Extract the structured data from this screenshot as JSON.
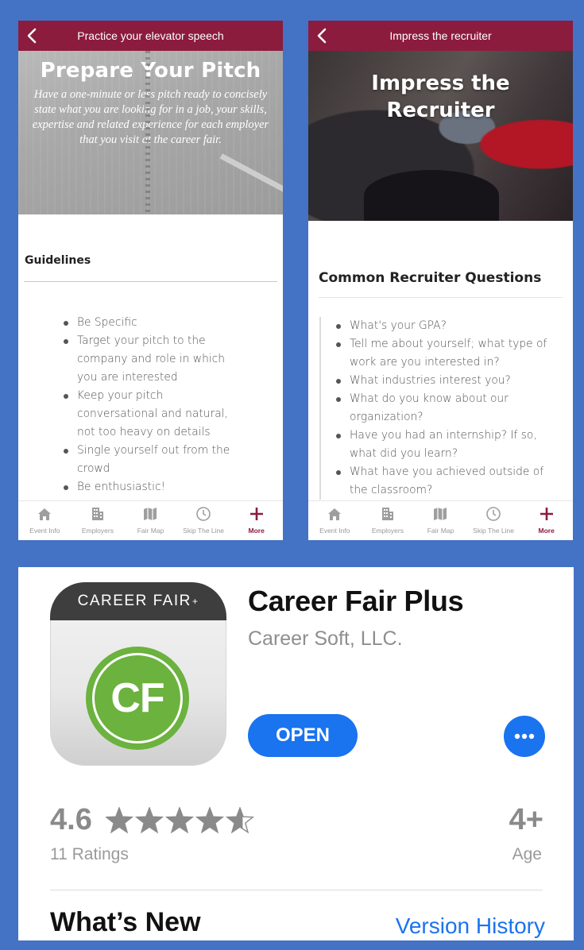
{
  "left_screen": {
    "title": "Practice your elevator speech",
    "hero_title": "Prepare Your Pitch",
    "hero_text": "Have a one-minute or less pitch ready to concisely state what you are looking for in a job, your skills, expertise and related experience for each employer that you visit at the career fair.",
    "section_heading": "Guidelines",
    "bullets": [
      "Be Specific",
      "Target your pitch to the company and role in which you are interested",
      "Keep your pitch conversational and natural, not too heavy on details",
      "Single yourself out from the crowd",
      "Be enthusiastic!"
    ]
  },
  "right_screen": {
    "title": "Impress the recruiter",
    "hero_title": "Impress the Recruiter",
    "section_heading": "Common Recruiter Questions",
    "bullets": [
      "What's your GPA?",
      "Tell me about yourself; what type of work are you interested in?",
      "What industries interest you?",
      "What do you know about our organization?",
      "Have you had an internship?  If so, what did you learn?",
      "What have you achieved outside of the classroom?"
    ]
  },
  "tabbar": {
    "tabs": [
      {
        "label": "Event Info",
        "icon": "home-icon"
      },
      {
        "label": "Employers",
        "icon": "building-icon"
      },
      {
        "label": "Fair Map",
        "icon": "map-icon"
      },
      {
        "label": "Skip The Line",
        "icon": "clock-icon"
      },
      {
        "label": "More",
        "icon": "plus-icon"
      }
    ],
    "active_index": 4
  },
  "app_store": {
    "icon_band_text": "CAREER FAIR",
    "icon_band_sup": "+",
    "icon_monogram": "CF",
    "app_name": "Career Fair Plus",
    "developer": "Career Soft, LLC.",
    "open_label": "OPEN",
    "rating": "4.6",
    "stars_value": 4.6,
    "ratings_count": "11 Ratings",
    "age": "4+",
    "age_label": "Age",
    "whats_new": "What’s New",
    "version_history": "Version History"
  },
  "colors": {
    "background": "#4472c4",
    "brand_maroon": "#8b1c3d",
    "ios_blue": "#1a73ef",
    "icon_green": "#6bb23e"
  }
}
